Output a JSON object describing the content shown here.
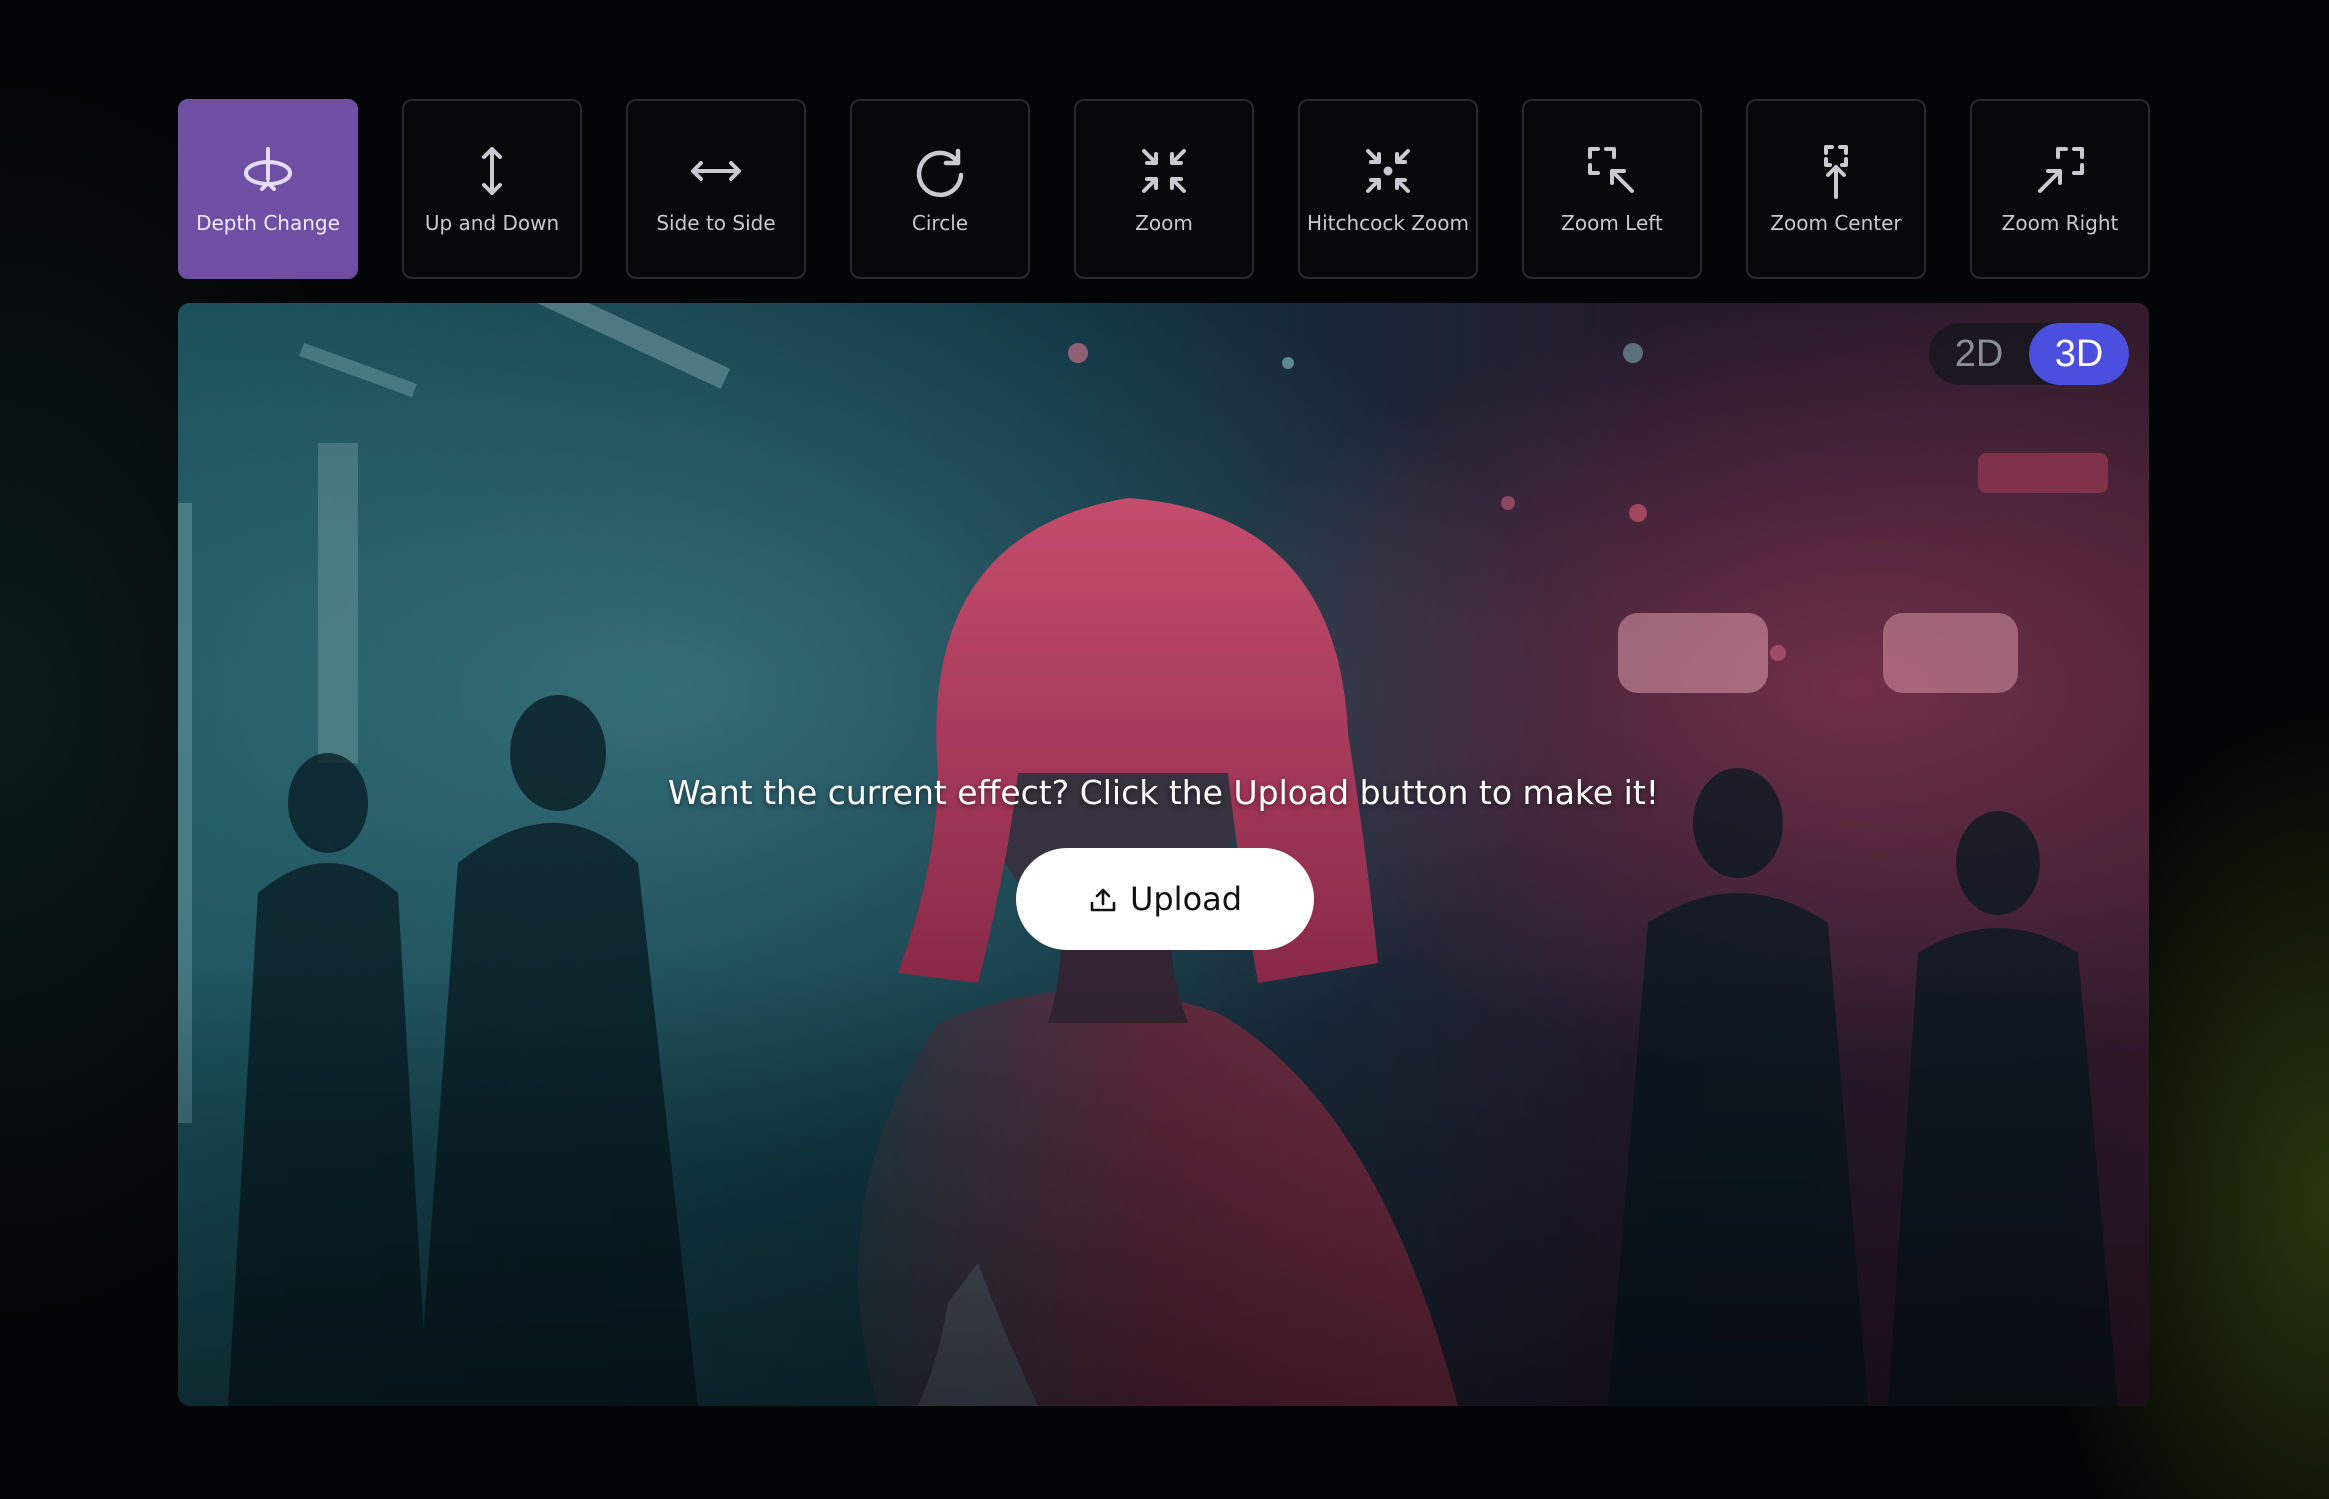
{
  "effects": [
    {
      "label": "Depth Change",
      "icon": "depth-change-icon",
      "active": true
    },
    {
      "label": "Up and Down",
      "icon": "up-down-arrow-icon",
      "active": false
    },
    {
      "label": "Side to Side",
      "icon": "left-right-arrow-icon",
      "active": false
    },
    {
      "label": "Circle",
      "icon": "circle-arrow-icon",
      "active": false
    },
    {
      "label": "Zoom",
      "icon": "zoom-in-arrows-icon",
      "active": false
    },
    {
      "label": "Hitchcock Zoom",
      "icon": "hitchcock-zoom-icon",
      "active": false
    },
    {
      "label": "Zoom Left",
      "icon": "zoom-left-icon",
      "active": false
    },
    {
      "label": "Zoom Center",
      "icon": "zoom-center-icon",
      "active": false
    },
    {
      "label": "Zoom Right",
      "icon": "zoom-right-icon",
      "active": false
    }
  ],
  "preview": {
    "mode_toggle": {
      "options": [
        "2D",
        "3D"
      ],
      "selected": "3D"
    },
    "cta_text": "Want the current effect? Click the Upload button to make it!",
    "upload_label": "Upload",
    "upload_icon": "upload-icon"
  },
  "colors": {
    "active_effect": "#6f4fa4",
    "toggle_active": "#4a4fe0"
  }
}
